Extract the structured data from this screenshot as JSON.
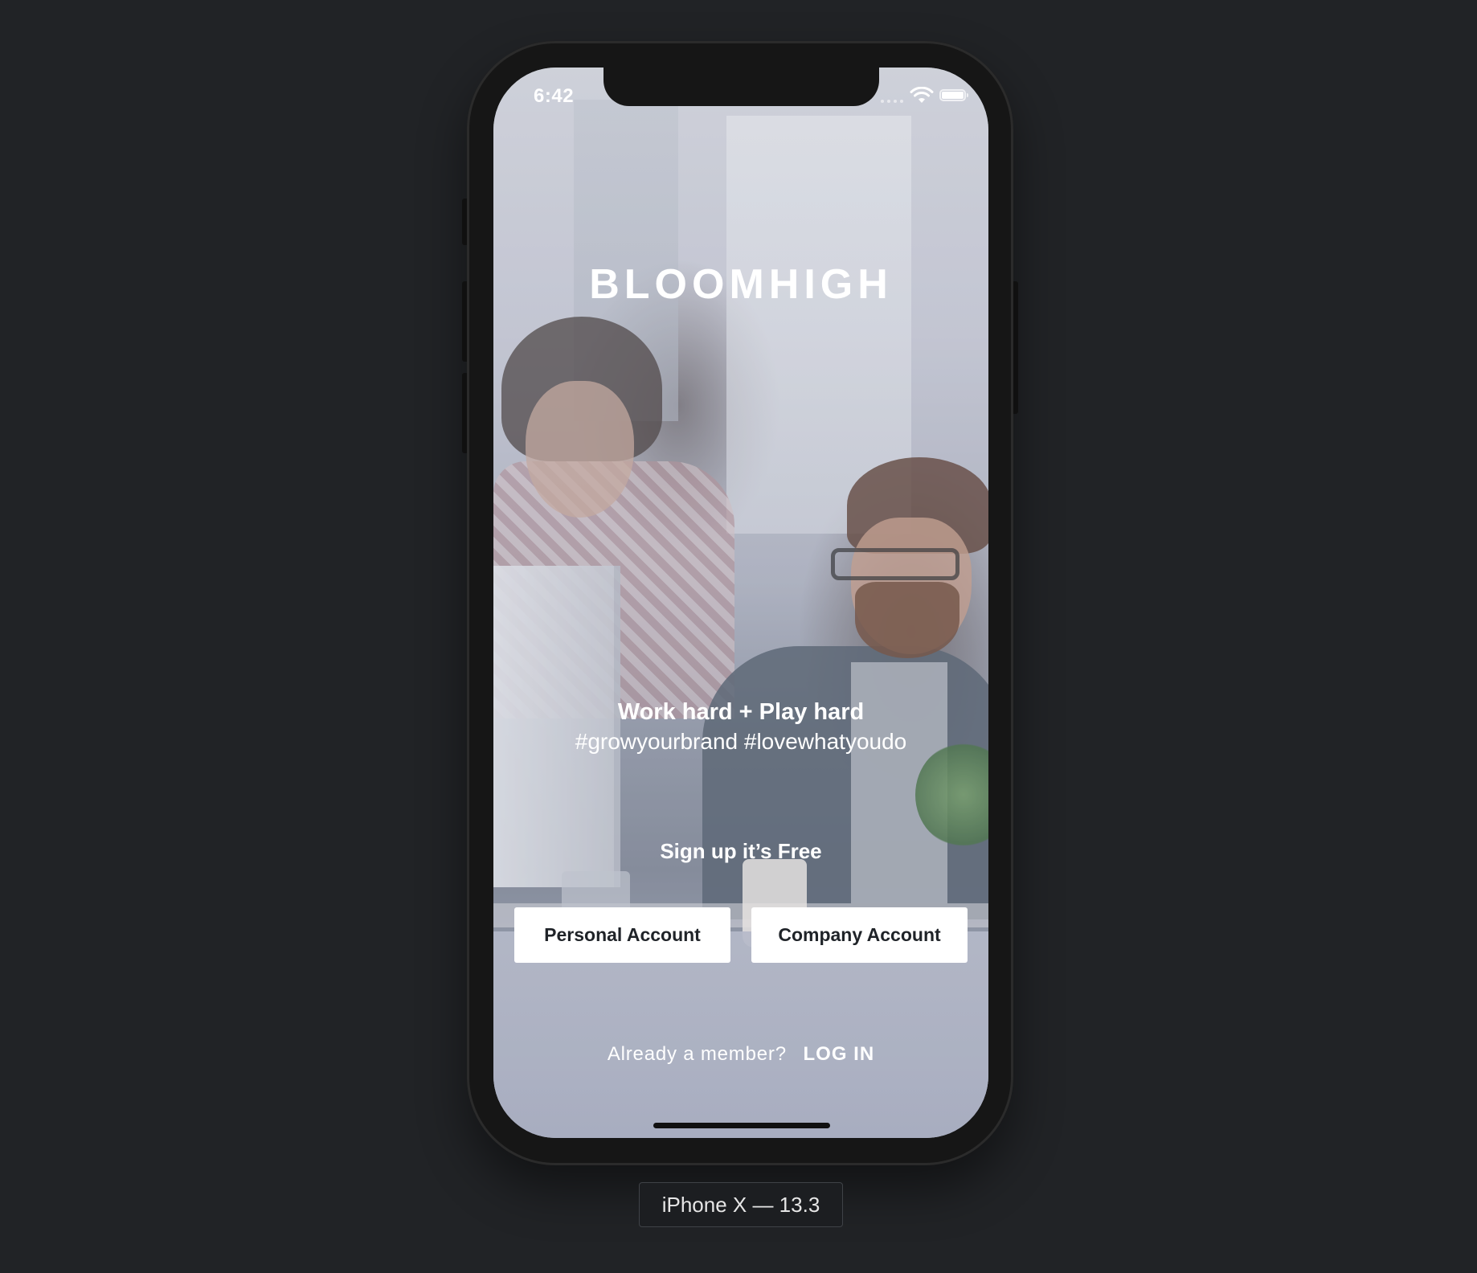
{
  "status_bar": {
    "time": "6:42",
    "wifi_icon": "wifi-icon",
    "battery_icon": "battery-icon"
  },
  "app": {
    "brand": "BLOOMHIGH",
    "tagline": "Work hard + Play hard",
    "hashtags": "#growyourbrand #lovewhatyoudo",
    "signup_label": "Sign up it’s Free",
    "personal_account_label": "Personal Account",
    "company_account_label": "Company Account",
    "login_prompt": "Already a member?",
    "login_link": "LOG IN"
  },
  "device_label": "iPhone X — 13.3",
  "colors": {
    "background": "#212326",
    "button_bg": "#ffffff",
    "button_text": "#1f2328",
    "text_on_photo": "#ffffff"
  }
}
